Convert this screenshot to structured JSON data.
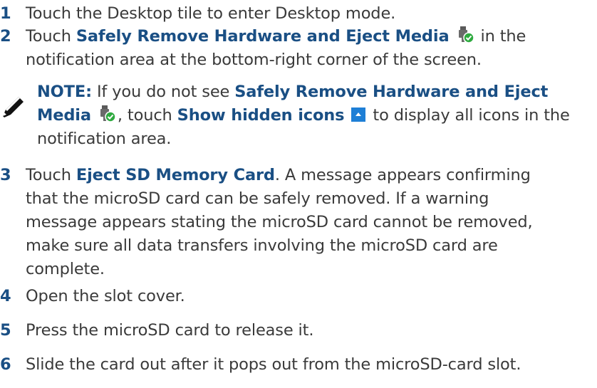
{
  "steps": [
    {
      "num": "1",
      "parts": [
        "Touch the Desktop tile to enter Desktop mode."
      ]
    },
    {
      "num": "2",
      "p1": "Touch ",
      "b1": "Safely Remove Hardware and Eject Media",
      "p2": " in the",
      "l2": "notification area at the bottom-right corner of the screen."
    },
    {
      "num": "3",
      "p1": "Touch ",
      "b1": "Eject SD Memory Card",
      "p2": ". A message appears confirming",
      "l2": "that the microSD card can be safely removed. If a warning",
      "l3": "message appears stating the microSD card cannot be removed,",
      "l4": "make sure all data transfers involving the microSD card are",
      "l5": "complete."
    },
    {
      "num": "4",
      "text": "Open the slot cover."
    },
    {
      "num": "5",
      "text": "Press the microSD card to release it."
    },
    {
      "num": "6",
      "text": "Slide the card out after it pops out from the microSD-card slot."
    }
  ],
  "note": {
    "label": "NOTE:",
    "p1": " If you do not see ",
    "b1": "Safely Remove Hardware and Eject",
    "b2": "Media",
    "p2": ", touch ",
    "b3": "Show hidden icons",
    "p3": " to display all icons in the",
    "l3": "notification area."
  },
  "icons": {
    "note": "pencil-icon",
    "eject": "usb-safely-remove-icon",
    "show_hidden": "show-hidden-icons-icon"
  },
  "colors": {
    "text": "#3a3a3a",
    "accent": "#1a4f84",
    "badge_green": "#2eaa3f",
    "hidden_icon_blue": "#1e7fd6"
  }
}
